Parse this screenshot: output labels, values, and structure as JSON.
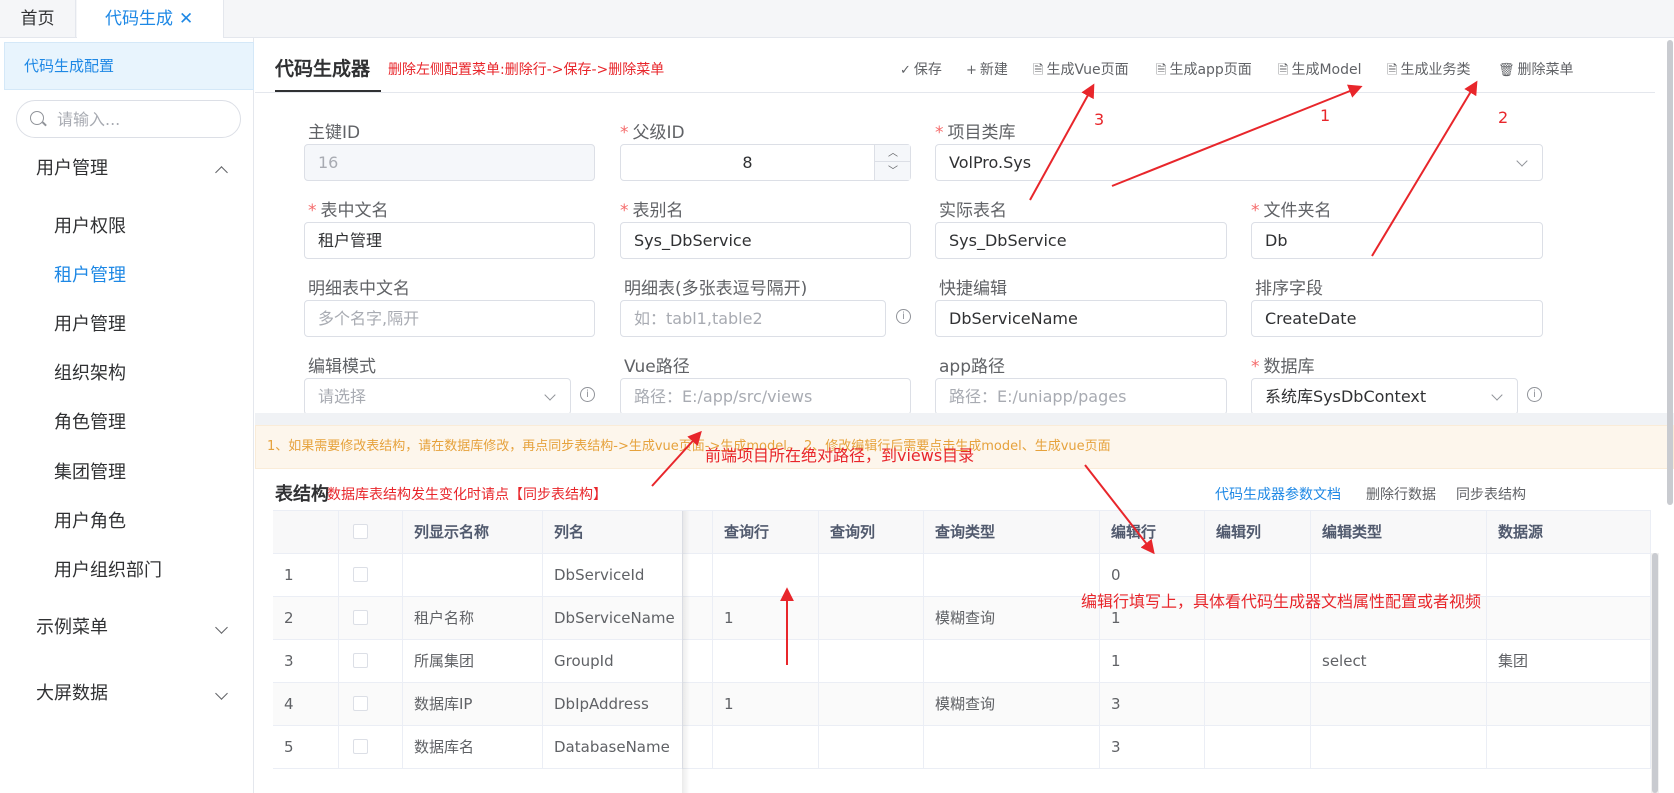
{
  "tabs": {
    "home": "首页",
    "active": "代码生成",
    "close": "✕"
  },
  "sidebar": {
    "header": "代码生成配置",
    "search_placeholder": "请输入...",
    "groups": [
      {
        "label": "用户管理"
      },
      {
        "label": "示例菜单"
      },
      {
        "label": "大屏数据"
      }
    ],
    "items": [
      {
        "label": "用户权限"
      },
      {
        "label": "租户管理"
      },
      {
        "label": "用户管理"
      },
      {
        "label": "组织架构"
      },
      {
        "label": "角色管理"
      },
      {
        "label": "集团管理"
      },
      {
        "label": "用户角色"
      },
      {
        "label": "用户组织部门"
      }
    ]
  },
  "header": {
    "title": "代码生成器",
    "note": "删除左侧配置菜单:删除行->保存->删除菜单",
    "toolbar": [
      {
        "icon": "check-icon",
        "glyph": "✓",
        "label": "保存"
      },
      {
        "icon": "plus-icon",
        "glyph": "+",
        "label": "新建"
      },
      {
        "icon": "document-icon",
        "glyph": "🗎",
        "label": "生成Vue页面"
      },
      {
        "icon": "document-icon",
        "glyph": "🗎",
        "label": "生成app页面"
      },
      {
        "icon": "document-icon",
        "glyph": "🗎",
        "label": "生成Model"
      },
      {
        "icon": "document-icon",
        "glyph": "🗎",
        "label": "生成业务类"
      },
      {
        "icon": "trash-icon",
        "glyph": "🗑",
        "label": "删除菜单"
      }
    ]
  },
  "form": {
    "pk_label": "主键ID",
    "pk_value": "16",
    "parent_label": "父级ID",
    "parent_value": "8",
    "project_label": "项目类库",
    "project_value": "VolPro.Sys",
    "table_cn_label": "表中文名",
    "table_cn_value": "租户管理",
    "alias_label": "表别名",
    "alias_value": "Sys_DbService",
    "real_label": "实际表名",
    "real_value": "Sys_DbService",
    "folder_label": "文件夹名",
    "folder_value": "Db",
    "detail_cn_label": "明细表中文名",
    "detail_cn_placeholder": "多个名字,隔开",
    "detail_label": "明细表(多张表逗号隔开)",
    "detail_placeholder": "如：tabl1,table2",
    "quick_label": "快捷编辑",
    "quick_value": "DbServiceName",
    "sort_label": "排序字段",
    "sort_value": "CreateDate",
    "edit_mode_label": "编辑模式",
    "edit_mode_placeholder": "请选择",
    "vue_path_label": "Vue路径",
    "vue_path_placeholder": "路径：E:/app/src/views",
    "app_path_label": "app路径",
    "app_path_placeholder": "路径：E:/uniapp/pages",
    "db_label": "数据库",
    "db_value": "系统库SysDbContext",
    "info_glyph": "i"
  },
  "notice": "1、如果需要修改表结构，请在数据库修改，再点同步表结构->生成vue页面->生成model。 2、修改编辑行后需要点击生成model、生成vue页面",
  "table_section": {
    "title": "表结构",
    "note": "数据库表结构发生变化时请点【同步表结构】",
    "links": [
      "代码生成器参数文档",
      "删除行数据",
      "同步表结构"
    ]
  },
  "table": {
    "columns": [
      "",
      "",
      "列显示名称",
      "列名",
      "",
      "查询行",
      "查询列",
      "查询类型",
      "编辑行",
      "编辑列",
      "编辑类型",
      "数据源"
    ],
    "rows": [
      [
        "1",
        "",
        "",
        "DbServiceId",
        "",
        "",
        "",
        "",
        "0",
        "",
        "",
        ""
      ],
      [
        "2",
        "",
        "租户名称",
        "DbServiceName",
        "",
        "1",
        "",
        "模糊查询",
        "1",
        "",
        "",
        ""
      ],
      [
        "3",
        "",
        "所属集团",
        "GroupId",
        "",
        "",
        "",
        "",
        "1",
        "",
        "select",
        "集团"
      ],
      [
        "4",
        "",
        "数据库IP",
        "DbIpAddress",
        "",
        "1",
        "",
        "模糊查询",
        "3",
        "",
        "",
        ""
      ],
      [
        "5",
        "",
        "数据库名",
        "DatabaseName",
        "",
        "",
        "",
        "",
        "3",
        "",
        "",
        ""
      ]
    ]
  },
  "annotations": {
    "n1": "1",
    "n2": "2",
    "n3": "3",
    "vue_path_tip": "前端项目所在绝对路径，到views目录",
    "edit_row_tip": "编辑行填写上，具体看代码生成器文档属性配置或者视频"
  },
  "colors": {
    "accent": "#1e88e5",
    "annotation": "#e8262b",
    "notice": "#e6a23c"
  }
}
